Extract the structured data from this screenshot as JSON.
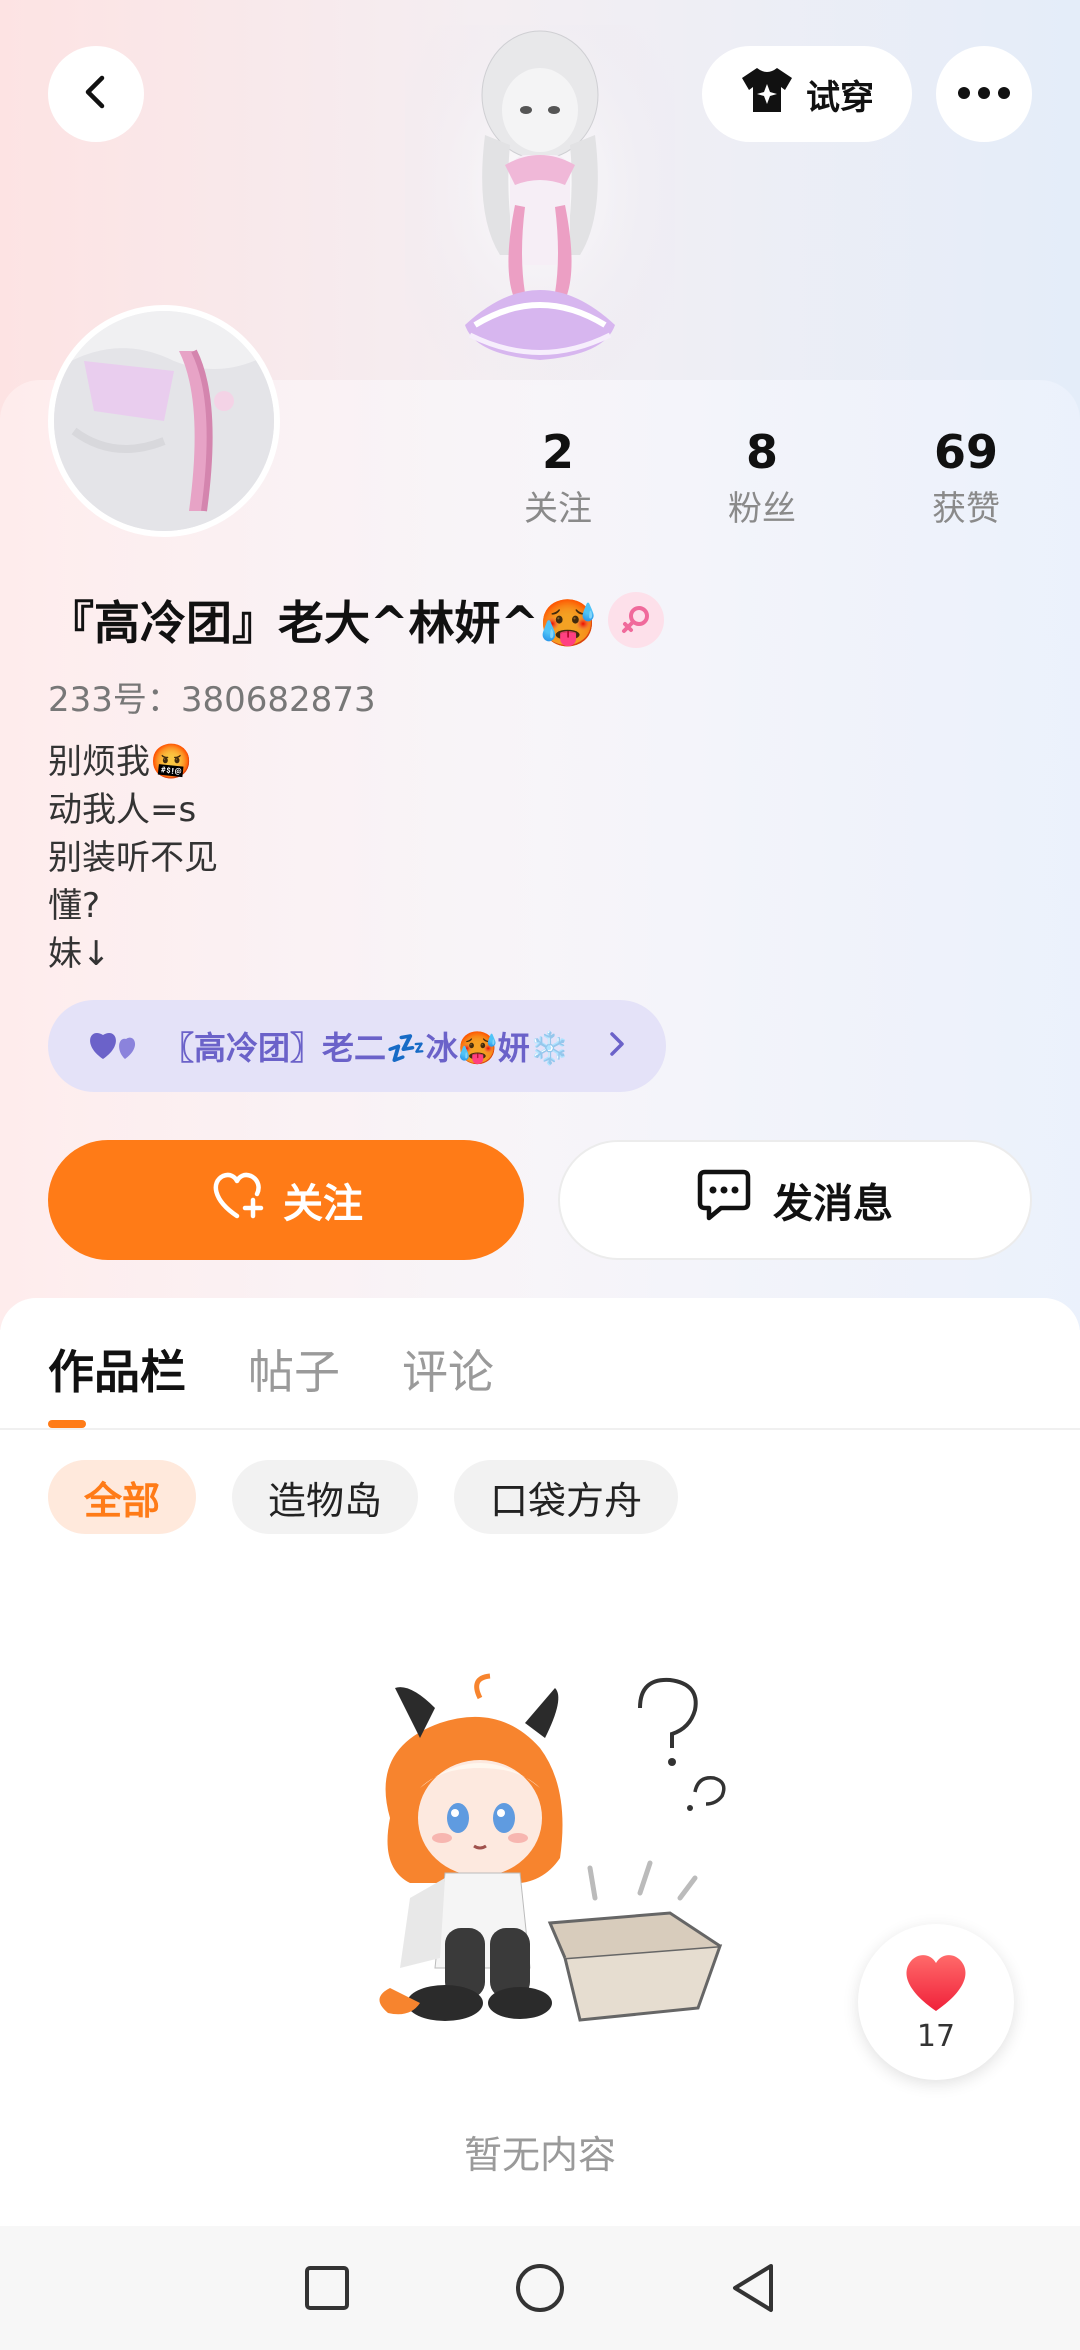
{
  "header": {
    "try_on_label": "试穿"
  },
  "stats": [
    {
      "value": "2",
      "label": "关注"
    },
    {
      "value": "8",
      "label": "粉丝"
    },
    {
      "value": "69",
      "label": "获赞"
    }
  ],
  "profile": {
    "name": "『高冷团』老大^林妍^🥵",
    "gender": "female",
    "uid": "233号：380682873",
    "bio": [
      "别烦我🤬",
      "动我人=s",
      "别装听不见",
      "懂?",
      "妹↓"
    ]
  },
  "relation": {
    "text": "〖高冷团〗老二💤冰🥵妍❄️"
  },
  "actions": {
    "follow_label": "关注",
    "message_label": "发消息"
  },
  "tabs": [
    {
      "label": "作品栏",
      "active": true
    },
    {
      "label": "帖子",
      "active": false
    },
    {
      "label": "评论",
      "active": false
    }
  ],
  "filters": [
    {
      "label": "全部",
      "active": true
    },
    {
      "label": "造物岛",
      "active": false
    },
    {
      "label": "口袋方舟",
      "active": false
    }
  ],
  "empty_state": {
    "text": "暂无内容"
  },
  "like_float": {
    "count": "17"
  },
  "colors": {
    "accent": "#ff7b17",
    "relation_text": "#6b62c9",
    "relation_bg": "#e4e2f8"
  }
}
